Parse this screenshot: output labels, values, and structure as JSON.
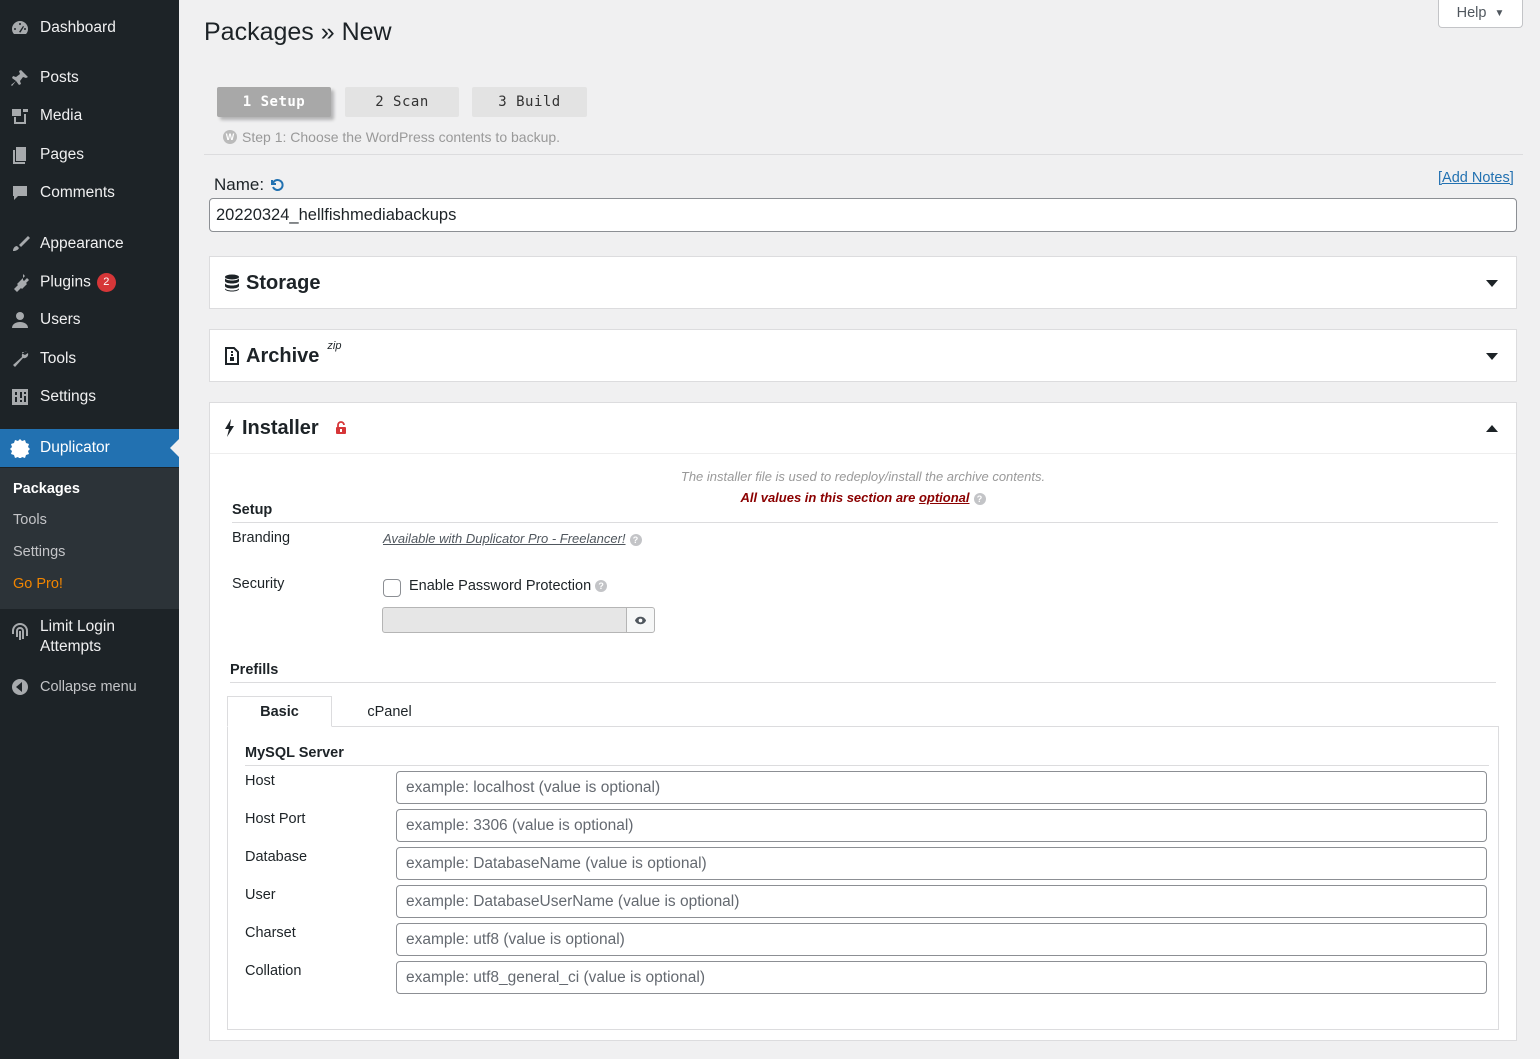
{
  "sidebar": {
    "menu": [
      {
        "label": "Dashboard",
        "icon": "dashboard-icon"
      },
      {
        "label": "Posts",
        "icon": "pushpin-icon"
      },
      {
        "label": "Media",
        "icon": "media-icon"
      },
      {
        "label": "Pages",
        "icon": "pages-icon"
      },
      {
        "label": "Comments",
        "icon": "comment-icon"
      },
      {
        "label": "Appearance",
        "icon": "paintbrush-icon"
      },
      {
        "label": "Plugins",
        "icon": "plugin-icon",
        "badge": "2"
      },
      {
        "label": "Users",
        "icon": "user-icon"
      },
      {
        "label": "Tools",
        "icon": "wrench-icon"
      },
      {
        "label": "Settings",
        "icon": "settings-icon"
      },
      {
        "label": "Duplicator",
        "icon": "duplicator-icon",
        "active": true
      },
      {
        "label": "Limit Login",
        "label2": "Attempts",
        "icon": "fingerprint-icon"
      },
      {
        "label": "Collapse menu",
        "icon": "collapse-icon"
      }
    ],
    "submenu": [
      {
        "label": "Packages",
        "current": true
      },
      {
        "label": "Tools"
      },
      {
        "label": "Settings"
      },
      {
        "label": "Go Pro!"
      }
    ]
  },
  "header": {
    "help_label": "Help",
    "title": "Packages » New"
  },
  "steps": {
    "items": [
      "1 Setup",
      "2 Scan",
      "3 Build"
    ],
    "active": 0,
    "description": "Step 1: Choose the WordPress contents to backup."
  },
  "name": {
    "label": "Name:",
    "value": "20220324_hellfishmediabackups",
    "add_notes": "[Add Notes]"
  },
  "panels": {
    "storage": {
      "title": "Storage",
      "expanded": false
    },
    "archive": {
      "title": "Archive",
      "suffix": "zip",
      "expanded": false
    },
    "installer": {
      "title": "Installer",
      "expanded": true
    }
  },
  "installer": {
    "note": "The installer file is used to redeploy/install the archive contents.",
    "optional_prefix": "All values in this section are ",
    "optional_word": "optional",
    "setup_title": "Setup",
    "branding_label": "Branding",
    "branding_link": "Available with Duplicator Pro - Freelancer!",
    "security_label": "Security",
    "password_protection_label": "Enable Password Protection",
    "password_protection_checked": false,
    "prefills_title": "Prefills",
    "tabs": [
      "Basic",
      "cPanel"
    ],
    "active_tab": 0,
    "mysql_title": "MySQL Server",
    "fields": [
      {
        "label": "Host",
        "placeholder": "example: localhost (value is optional)"
      },
      {
        "label": "Host Port",
        "placeholder": "example: 3306 (value is optional)"
      },
      {
        "label": "Database",
        "placeholder": "example: DatabaseName (value is optional)"
      },
      {
        "label": "User",
        "placeholder": "example: DatabaseUserName (value is optional)"
      },
      {
        "label": "Charset",
        "placeholder": "example: utf8 (value is optional)"
      },
      {
        "label": "Collation",
        "placeholder": "example: utf8_general_ci (value is optional)"
      }
    ]
  },
  "colors": {
    "sidebar_bg": "#1d2327",
    "accent": "#2271b1",
    "badge": "#d63638",
    "go_pro": "#f18500",
    "optional_text": "#8b0000",
    "lock": "#d63638"
  }
}
